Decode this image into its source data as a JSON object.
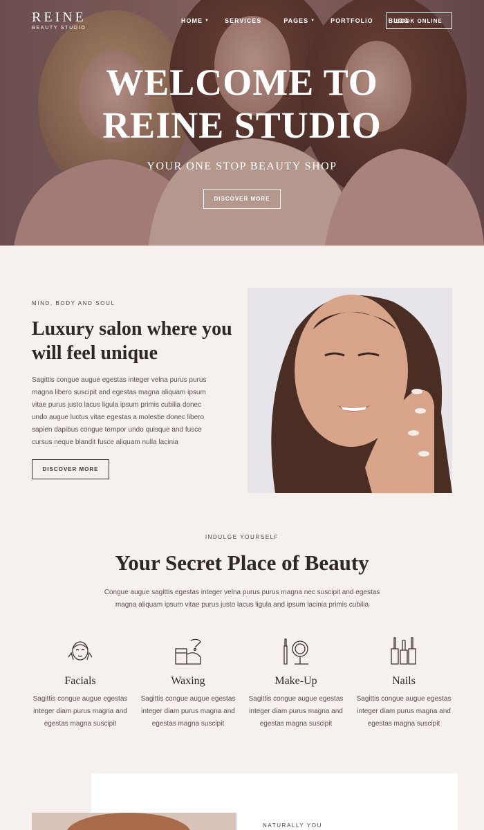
{
  "brand": {
    "name": "REINE",
    "tagline": "BEAUTY STUDIO"
  },
  "nav": {
    "items": [
      {
        "label": "HOME",
        "dropdown": true
      },
      {
        "label": "SERVICES",
        "dropdown": false
      },
      {
        "label": "PAGES",
        "dropdown": true
      },
      {
        "label": "PORTFOLIO",
        "dropdown": false
      },
      {
        "label": "BLOG",
        "dropdown": false
      }
    ],
    "book_label": "BOOK ONLINE"
  },
  "hero": {
    "title_line1": "WELCOME TO",
    "title_line2": "REINE STUDIO",
    "subtitle": "YOUR ONE STOP BEAUTY SHOP",
    "button": "DISCOVER MORE"
  },
  "about": {
    "eyebrow": "MIND, BODY AND SOUL",
    "title": "Luxury salon where you will feel unique",
    "text": "Sagittis congue augue egestas integer velna purus purus magna libero suscipit and egestas magna aliquam ipsum vitae purus justo lacus ligula ipsum primis cubilia donec undo augue luctus vitae egestas a molestie donec libero sapien dapibus congue tempor undo quisque and fusce cursus neque blandit fusce aliquam nulla lacinia",
    "button": "DISCOVER MORE"
  },
  "services": {
    "eyebrow": "INDULGE YOURSELF",
    "title": "Your Secret Place of Beauty",
    "text": "Congue augue sagittis egestas integer velna purus purus magna nec suscipit and egestas magna aliquam ipsum vitae purus justo lacus ligula and ipsum lacinia primis cubilia",
    "items": [
      {
        "name": "Facials",
        "icon": "face-icon",
        "desc": "Sagittis congue augue egestas integer diam purus magna and egestas magna suscipit"
      },
      {
        "name": "Waxing",
        "icon": "wax-pot-icon",
        "desc": "Sagittis congue augue egestas integer diam purus magna and egestas magna suscipit"
      },
      {
        "name": "Make-Up",
        "icon": "makeup-mirror-icon",
        "desc": "Sagittis congue augue egestas integer diam purus magna and egestas magna suscipit"
      },
      {
        "name": "Nails",
        "icon": "nail-polish-icon",
        "desc": "Sagittis congue augue egestas integer diam purus magna and egestas magna suscipit"
      }
    ]
  },
  "next_section": {
    "eyebrow": "NATURALLY YOU"
  },
  "colors": {
    "background": "#f6f1ee",
    "hero_tint": "#8c6a66",
    "text_dark": "#2f2626",
    "text_body": "#5a4e4e",
    "card": "#ffffff"
  }
}
